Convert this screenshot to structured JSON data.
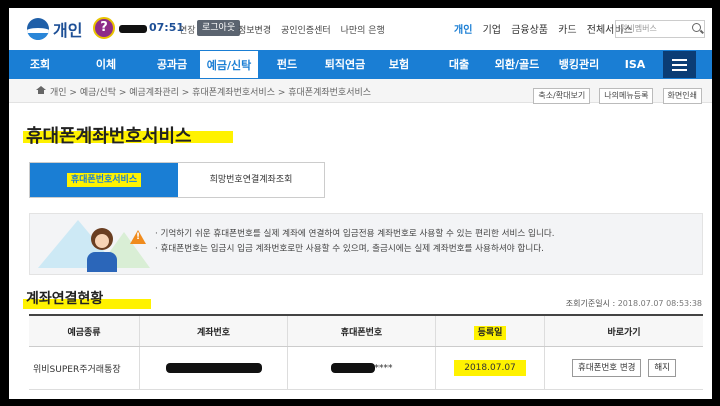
{
  "header": {
    "brand": "개인",
    "timer": "07:51",
    "extend": "연장",
    "logout": "로그아웃",
    "links": [
      "정보변경",
      "공인인증센터",
      "나만의 은행"
    ],
    "segments": [
      "개인",
      "기업",
      "금융상품",
      "카드",
      "전체서비스"
    ],
    "search_placeholder": "위비멤버스"
  },
  "nav": {
    "items": [
      "조회",
      "이체",
      "공과금",
      "예금/신탁",
      "펀드",
      "퇴직연금",
      "보험",
      "대출",
      "외환/골드",
      "뱅킹관리",
      "ISA"
    ],
    "active_index": 3
  },
  "breadcrumb": {
    "path": "개인 > 예금/신탁 > 예금계좌관리 > 휴대폰계좌번호서비스 > 휴대폰계좌번호서비스",
    "buttons": [
      "축소/확대보기",
      "나의메뉴등록",
      "화면인쇄"
    ]
  },
  "page": {
    "title": "휴대폰계좌번호서비스",
    "tabs": [
      "휴대폰번호서비스",
      "희망번호연결계좌조회"
    ],
    "active_tab": 0,
    "info": [
      "기억하기 쉬운 휴대폰번호를 실제 계좌에 연결하여 입금전용 계좌번호로 사용할 수 있는 편리한 서비스 입니다.",
      "휴대폰번호는 입금시 입금 계좌번호로만 사용할 수 있으며, 출금시에는 실제 계좌번호를 사용하셔야 합니다."
    ]
  },
  "section": {
    "title": "계좌연결현황",
    "ref_label": "조회기준일시 :",
    "ref_value": "2018.07.07 08:53:38"
  },
  "table": {
    "headers": [
      "예금종류",
      "계좌번호",
      "휴대폰번호",
      "등록일",
      "바로가기"
    ],
    "rows": [
      {
        "type": "위비SUPER주거래통장",
        "phone_suffix": "****",
        "date": "2018.07.07",
        "btn_change": "휴대폰번호 변경",
        "btn_cancel": "해지"
      }
    ]
  },
  "colors": {
    "primary": "#1a7ed4",
    "highlight": "#fff200",
    "menu_btn": "#0b3d75"
  }
}
